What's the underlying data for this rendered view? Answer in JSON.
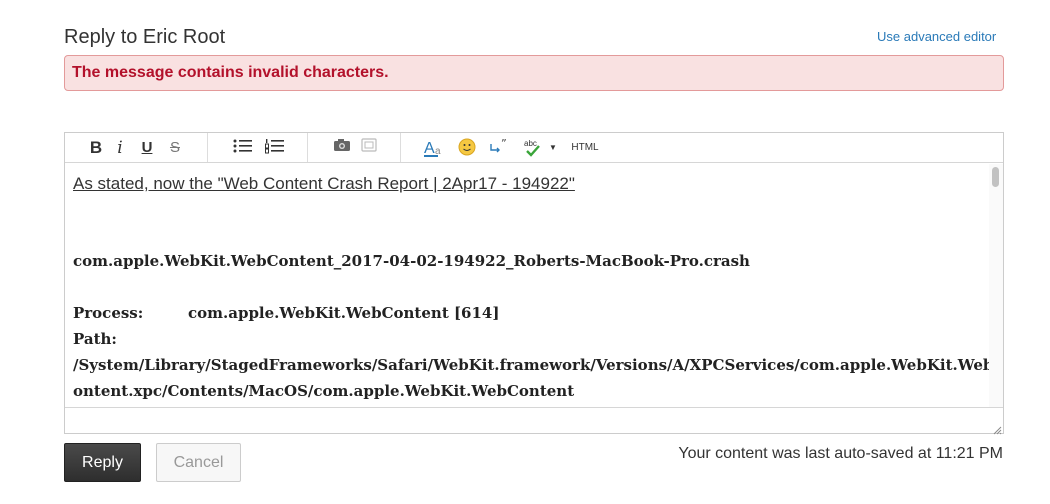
{
  "header": {
    "title": "Reply to Eric Root",
    "advanced_editor_link": "Use advanced editor"
  },
  "error": {
    "message": "The message contains invalid characters."
  },
  "toolbar": {
    "bold": "B",
    "italic": "i",
    "underline": "U",
    "strike": "S",
    "html": "HTML",
    "spell": "abc"
  },
  "content": {
    "intro": "As stated, now the \"Web Content Crash Report | 2Apr17 - 194922\"",
    "crash_file": "com.apple.WebKit.WebContent_2017-04-02-194922_Roberts-MacBook-Pro.crash",
    "process_label": "Process:",
    "process_value": "com.apple.WebKit.WebContent [614]",
    "path_label": "Path:",
    "path_line1": "/System/Library/StagedFrameworks/Safari/WebKit.framework/Versions/A/XPCServices/com.apple.WebKit.WebC",
    "path_line2": "ontent.xpc/Contents/MacOS/com.apple.WebKit.WebContent"
  },
  "actions": {
    "reply": "Reply",
    "cancel": "Cancel"
  },
  "autosave": {
    "text": "Your content was last auto-saved at 11:21 PM"
  },
  "colors": {
    "link": "#2a7ab8",
    "error_text": "#b3112b",
    "error_bg": "#f9e1e1",
    "error_border": "#e39a9a",
    "reply_button": "#3a3a3a"
  },
  "icons": [
    "bold-icon",
    "italic-icon",
    "underline-icon",
    "strikethrough-icon",
    "bulleted-list-icon",
    "numbered-list-icon",
    "insert-image-icon",
    "insert-video-icon",
    "text-format-icon",
    "emoji-icon",
    "quote-icon",
    "spellcheck-icon",
    "dropdown-arrow-icon",
    "html-icon",
    "resize-handle-icon"
  ]
}
